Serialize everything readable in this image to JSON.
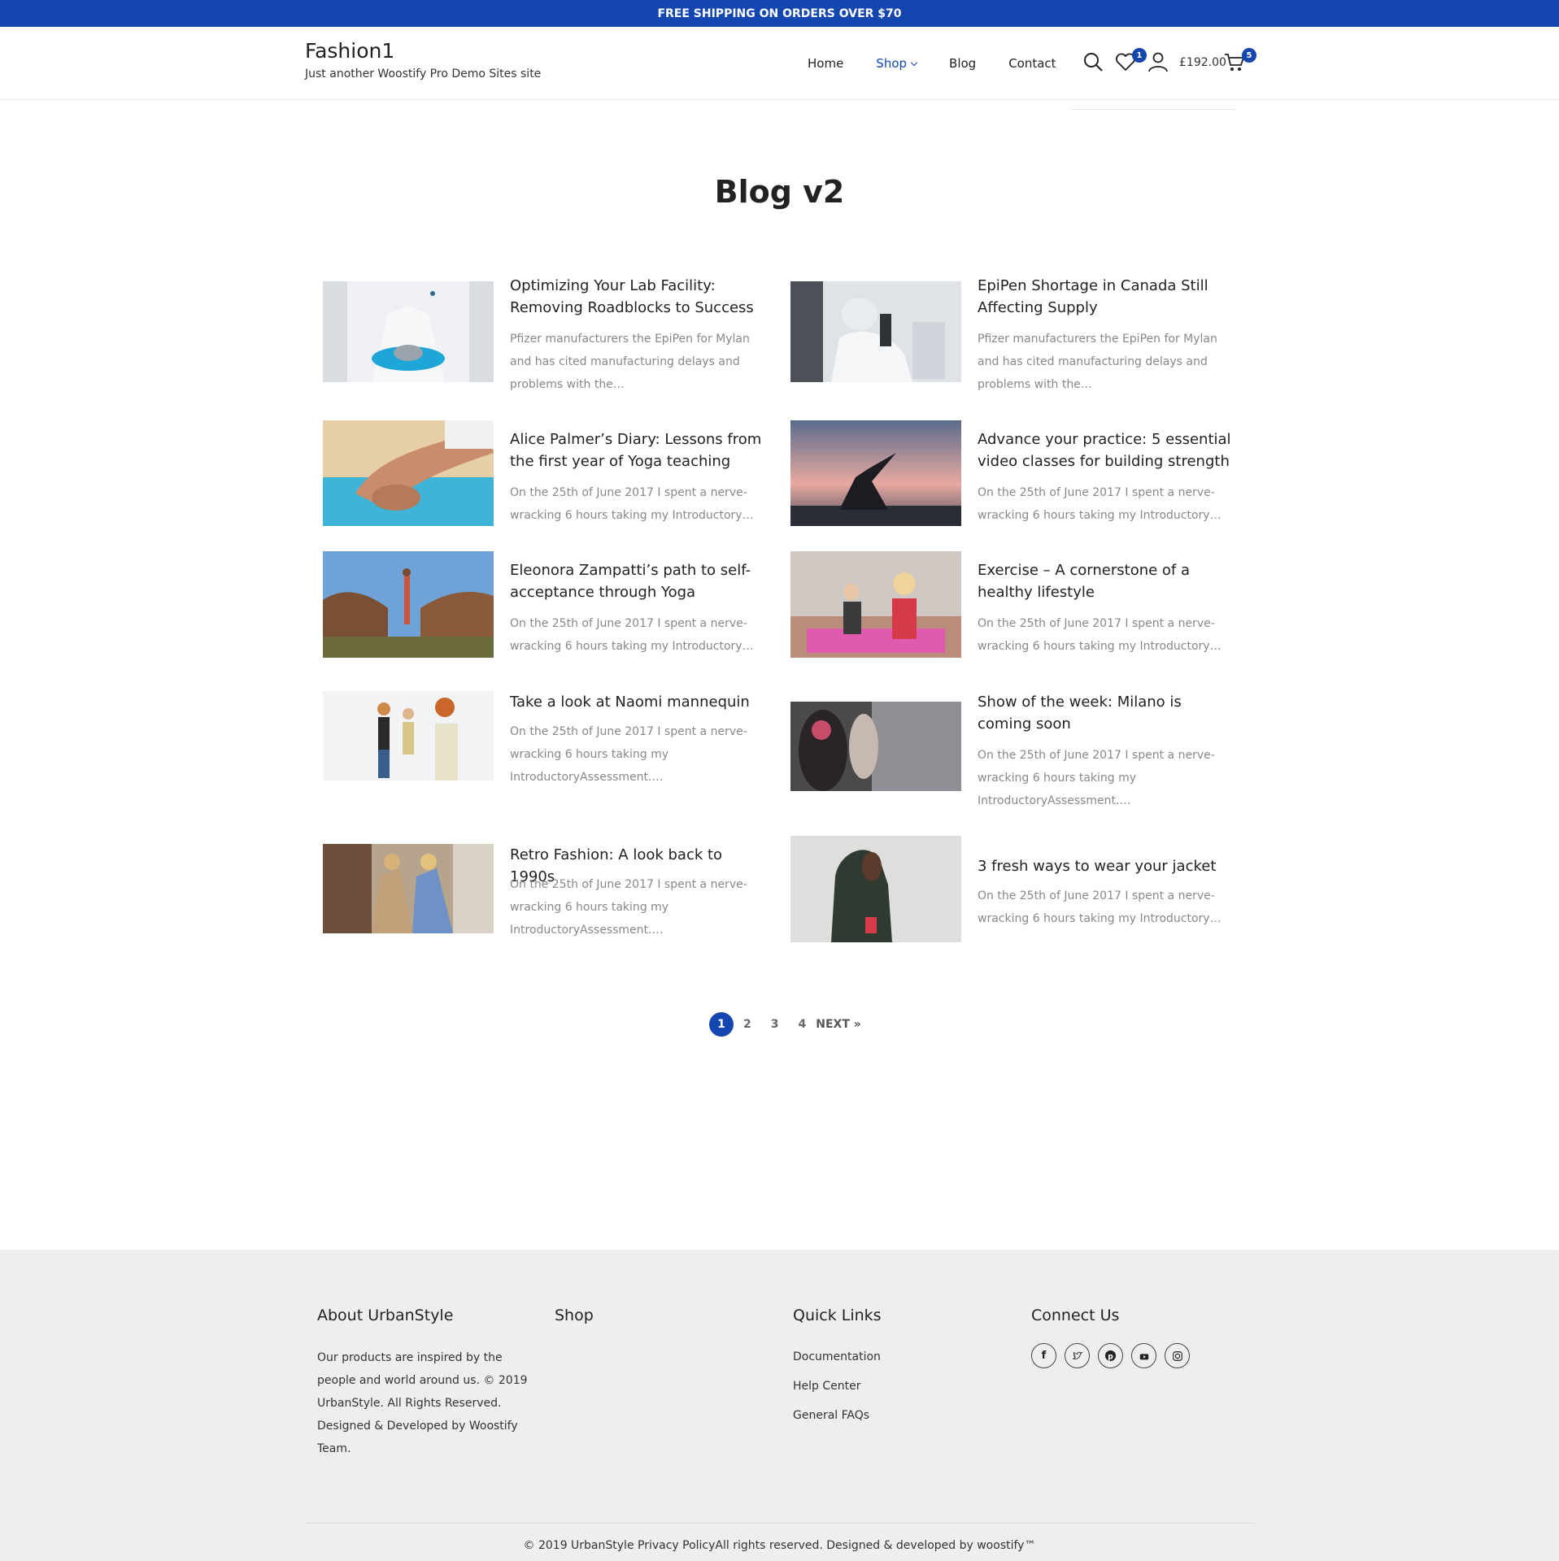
{
  "topbar": {
    "text": "FREE SHIPPING ON ORDERS OVER $70"
  },
  "header": {
    "site_title": "Fashion1",
    "tagline": "Just another Woostify Pro Demo Sites site",
    "nav": [
      {
        "label": "Home"
      },
      {
        "label": "Shop"
      },
      {
        "label": "Blog"
      },
      {
        "label": "Contact"
      }
    ],
    "wishlist_count": "1",
    "cart_total": "£192.00",
    "cart_count": "5",
    "accent": "#1346af"
  },
  "page": {
    "title": "Blog v2"
  },
  "posts": [
    {
      "title": "Optimizing Your Lab Facility: Removing Roadblocks to Success",
      "excerpt": "Pfizer manufacturers the EpiPen for Mylan and has cited manufacturing delays and problems with the…"
    },
    {
      "title": "EpiPen Shortage in Canada Still Affecting Supply",
      "excerpt": "Pfizer manufacturers the EpiPen for Mylan and has cited manufacturing delays and problems with the…"
    },
    {
      "title": "Alice Palmer’s Diary: Lessons from the first year of Yoga teaching",
      "excerpt": "On the 25th of June 2017 I spent a nerve-wracking 6 hours taking my Introductory…"
    },
    {
      "title": "Advance your practice: 5 essential video classes for building strength",
      "excerpt": "On the 25th of June 2017 I spent a nerve-wracking 6 hours taking my Introductory…"
    },
    {
      "title": "Eleonora Zampatti’s path to self-acceptance through Yoga",
      "excerpt": "On the 25th of June 2017 I spent a nerve-wracking 6 hours taking my Introductory…"
    },
    {
      "title": "Exercise – A cornerstone of a healthy lifestyle",
      "excerpt": "On the 25th of June 2017 I spent a nerve-wracking 6 hours taking my Introductory…"
    },
    {
      "title": "Take a look at Naomi mannequin",
      "excerpt": "On the 25th of June 2017 I spent a nerve-wracking 6 hours taking my IntroductoryAssessment.…"
    },
    {
      "title": "Show of the week: Milano is coming soon",
      "excerpt": "On the 25th of June 2017 I spent a nerve-wracking 6 hours taking my IntroductoryAssessment.…"
    },
    {
      "title": "Retro Fashion: A look back to 1990s",
      "excerpt": "On the 25th of June 2017 I spent a nerve-wracking 6 hours taking my IntroductoryAssessment.…"
    },
    {
      "title": "3 fresh ways to wear your jacket",
      "excerpt": "On the 25th of June 2017 I spent a nerve-wracking 6 hours taking my Introductory…"
    }
  ],
  "pagination": {
    "current": "1",
    "pages": [
      "2",
      "3",
      "4"
    ],
    "next": "NEXT »"
  },
  "footer": {
    "about_heading": "About UrbanStyle",
    "about_text": "Our products are inspired by the people and world around us. © 2019 UrbanStyle. All Rights Reserved. Designed & Developed by Woostify Team.",
    "shop_heading": "Shop",
    "links_heading": "Quick Links",
    "links": [
      "Documentation",
      "Help Center",
      "General FAQs"
    ],
    "connect_heading": "Connect Us",
    "social_icons": [
      "facebook-icon",
      "twitter-icon",
      "pinterest-icon",
      "youtube-icon",
      "instagram-icon"
    ],
    "bottom_text": "© 2019 UrbanStyle Privacy PolicyAll rights reserved. Designed & developed by woostify™"
  }
}
